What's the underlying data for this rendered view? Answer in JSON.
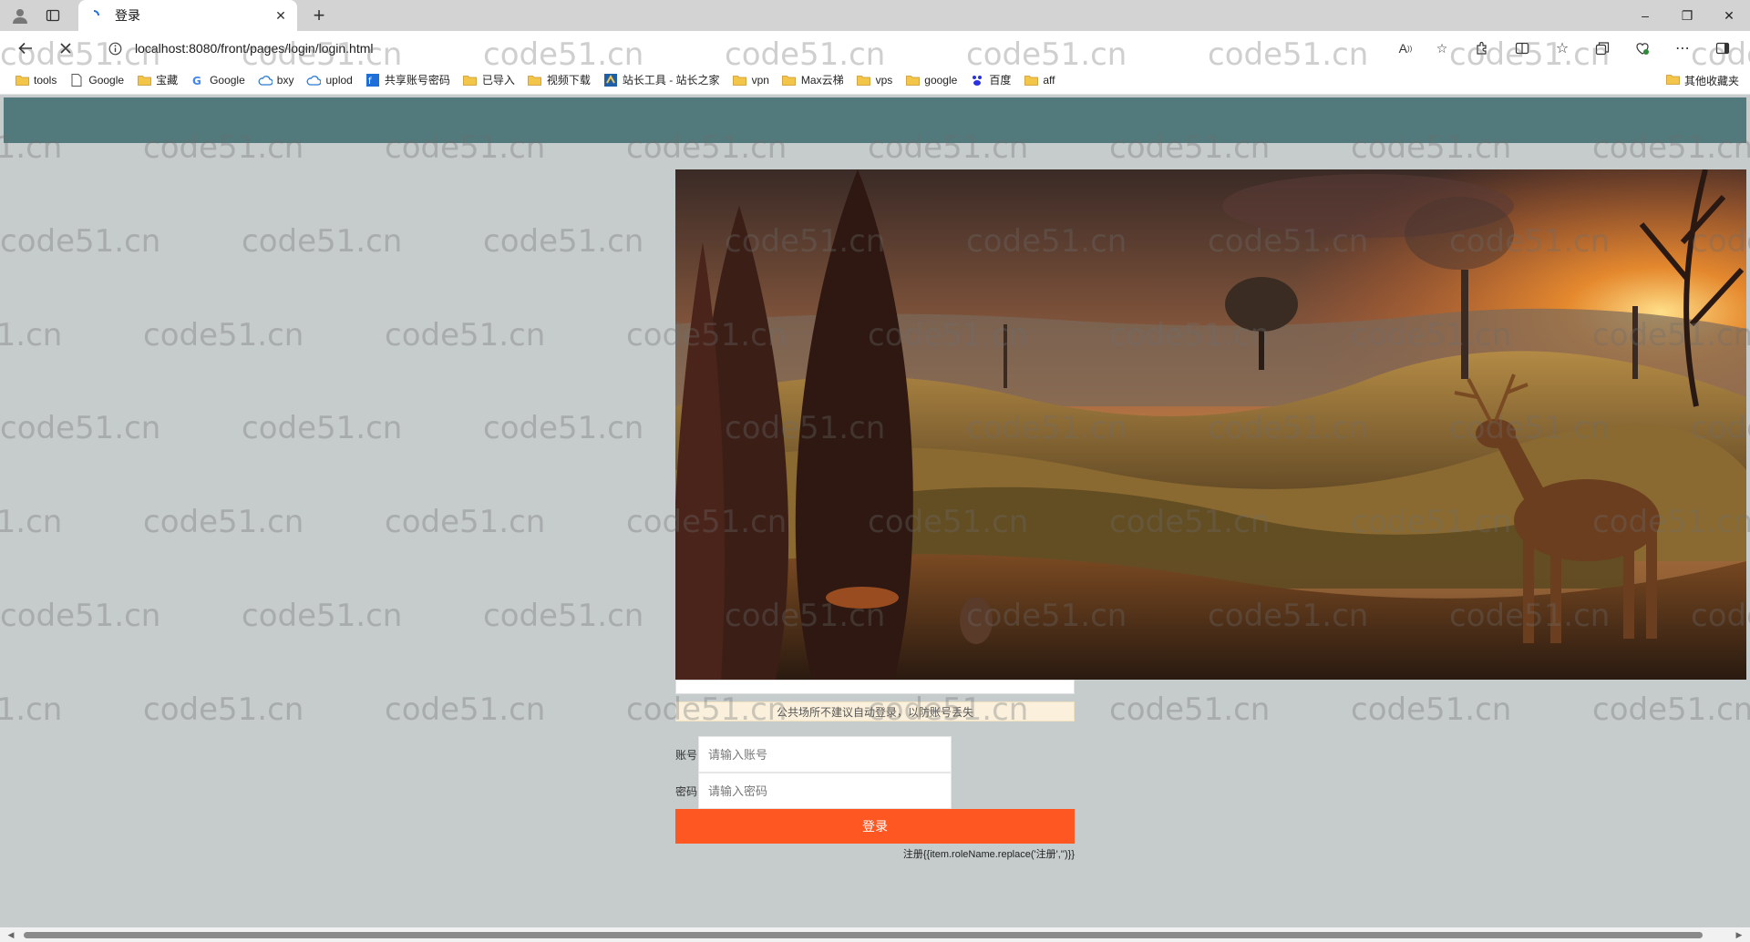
{
  "browser": {
    "tab_title": "登录",
    "url": "localhost:8080/front/pages/login/login.html",
    "new_tab_glyph": "+",
    "close_glyph": "✕",
    "window_controls": [
      "–",
      "❐",
      "✕"
    ]
  },
  "bookmarks": {
    "items": [
      {
        "label": "tools",
        "icon": "folder-icon"
      },
      {
        "label": "Google",
        "icon": "page-icon"
      },
      {
        "label": "宝藏",
        "icon": "folder-icon"
      },
      {
        "label": "Google",
        "icon": "google-icon"
      },
      {
        "label": "bxy",
        "icon": "cloud-icon"
      },
      {
        "label": "uplod",
        "icon": "cloud-icon"
      },
      {
        "label": "共享账号密码",
        "icon": "share-icon"
      },
      {
        "label": "已导入",
        "icon": "folder-icon"
      },
      {
        "label": "视频下载",
        "icon": "folder-icon"
      },
      {
        "label": "站长工具 - 站长之家",
        "icon": "site-icon"
      },
      {
        "label": "vpn",
        "icon": "folder-icon"
      },
      {
        "label": "Max云梯",
        "icon": "folder-icon"
      },
      {
        "label": "vps",
        "icon": "folder-icon"
      },
      {
        "label": "google",
        "icon": "folder-icon"
      },
      {
        "label": "百度",
        "icon": "baidu-icon"
      },
      {
        "label": "aff",
        "icon": "folder-icon"
      }
    ],
    "other_label": "其他收藏夹"
  },
  "login": {
    "notice": "公共场所不建议自动登录，以防账号丢失",
    "account_label": "账号",
    "account_placeholder": "请输入账号",
    "password_label": "密码",
    "password_placeholder": "请输入密码",
    "login_button": "登录",
    "register_link": "注册{{item.roleName.replace('注册','')}}"
  },
  "watermark": {
    "text": "code51.cn",
    "color": "#6e6e6e"
  },
  "colors": {
    "header": "#527a7d",
    "page_bg": "#c6cbcb",
    "login_button": "#ff5722",
    "notice_bg": "#faf0dc"
  }
}
